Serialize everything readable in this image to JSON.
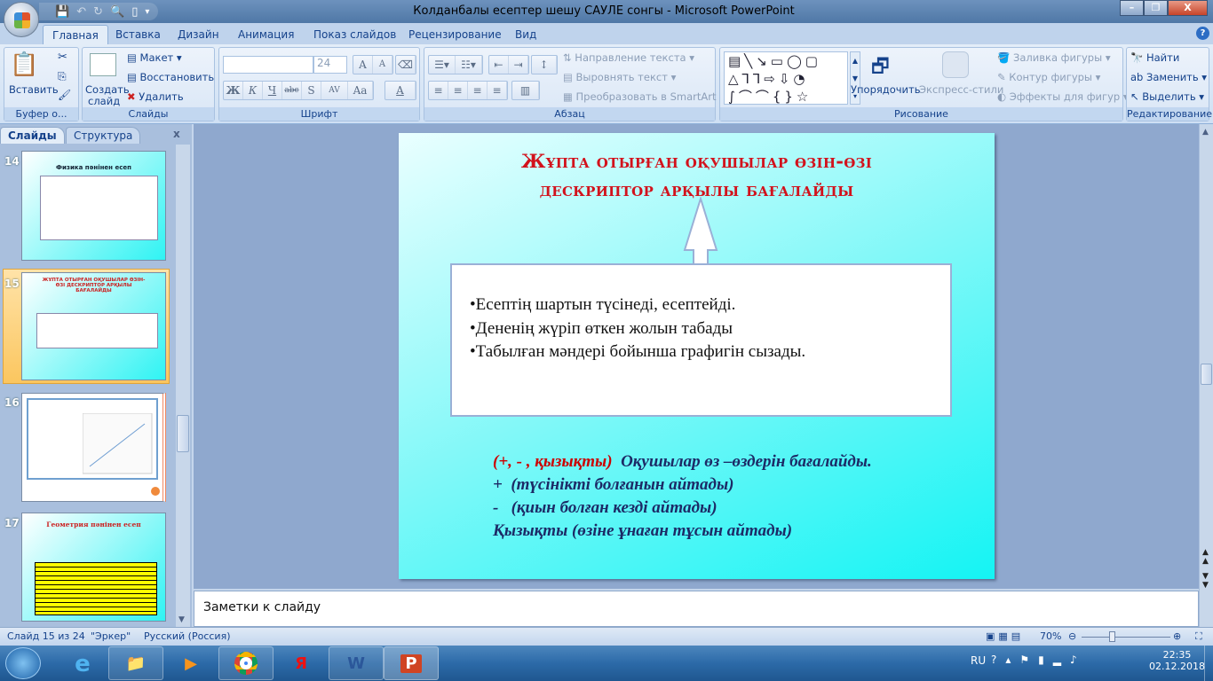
{
  "window": {
    "title": "Колданбалы есептер шешу САУЛЕ сонгы - Microsoft PowerPoint",
    "controls": [
      "minimize",
      "restore",
      "close"
    ]
  },
  "quick_access": {
    "icons": [
      "save-icon",
      "undo-icon",
      "redo-icon",
      "print-preview-icon",
      "new-icon",
      "customize-icon"
    ]
  },
  "ribbon": {
    "tabs": [
      "Главная",
      "Вставка",
      "Дизайн",
      "Анимация",
      "Показ слайдов",
      "Рецензирование",
      "Вид"
    ],
    "active_tab": "Главная",
    "groups": {
      "clipboard": {
        "label": "Буфер о...",
        "paste": "Вставить"
      },
      "slides": {
        "label": "Слайды",
        "new_slide_1": "Создать",
        "new_slide_2": "слайд",
        "layout": "Макет",
        "reset": "Восстановить",
        "delete": "Удалить"
      },
      "font": {
        "label": "Шрифт",
        "font_name": "",
        "font_size": "24",
        "bold": "Ж",
        "italic": "К",
        "underline": "Ч",
        "strike": "abc",
        "shadow": "S",
        "spacing": "AV",
        "case": "Aa",
        "grow": "A",
        "shrink": "A",
        "color": "A"
      },
      "paragraph": {
        "label": "Абзац",
        "text_direction": "Направление текста",
        "align_text": "Выровнять текст",
        "smartart": "Преобразовать в SmartArt"
      },
      "drawing": {
        "label": "Рисование",
        "arrange": "Упорядочить",
        "quick_styles": "Экспресс-стили",
        "shape_fill": "Заливка фигуры",
        "shape_outline": "Контур фигуры",
        "shape_effects": "Эффекты для фигур"
      },
      "editing": {
        "label": "Редактирование",
        "find": "Найти",
        "replace": "Заменить",
        "select": "Выделить"
      }
    }
  },
  "left_pane": {
    "tabs": [
      "Слайды",
      "Структура"
    ],
    "active_tab": "Слайды",
    "thumbnails": [
      {
        "number": "14",
        "title": "Физика пәнінен есеп"
      },
      {
        "number": "15",
        "title": "ЖҰПТА ОТЫРҒАН ОҚУШЫЛАР ӨЗІН-ӨЗІ ДЕСКРИПТОР АРҚЫЛЫ БАҒАЛАЙДЫ",
        "selected": true
      },
      {
        "number": "16",
        "title": ""
      },
      {
        "number": "17",
        "title": "Геометрия пәнінен есеп"
      }
    ]
  },
  "slide": {
    "title_line1": "Жұпта отырған оқушылар өзін-өзі",
    "title_line2": "дескриптор арқылы бағалайды",
    "bullets": [
      "•Есептің шартын түсінеді, есептейді.",
      "•Дененің жүріп өткен жолын табады",
      "•Табылған мәндері бойынша графигін сызады."
    ],
    "assessment": {
      "line1_red": "(+, - , қызықты)",
      "line1_rest": "  Оқушылар өз –өздерін бағалайды.",
      "line2": "+  (түсінікті болғанын айтады)",
      "line3": "-   (қиын болған кезді айтады)",
      "line4": "Қызықты (өзіне ұнаған тұсын айтады)"
    },
    "colors": {
      "title": "#d2121c",
      "body": "#1c2a66",
      "background_end": "#14f4f4"
    }
  },
  "notes": {
    "placeholder": "Заметки к слайду"
  },
  "status_bar": {
    "slide": "Слайд 15 из 24",
    "theme": "\"Эркер\"",
    "language": "Русский (Россия)",
    "zoom": "70%",
    "zoom_value": 70
  },
  "taskbar": {
    "apps": [
      "internet-explorer",
      "file-explorer",
      "media-player",
      "chrome",
      "yandex-browser",
      "word",
      "powerpoint"
    ],
    "tray": {
      "lang": "RU",
      "time": "22:35",
      "date": "02.12.2018"
    }
  }
}
